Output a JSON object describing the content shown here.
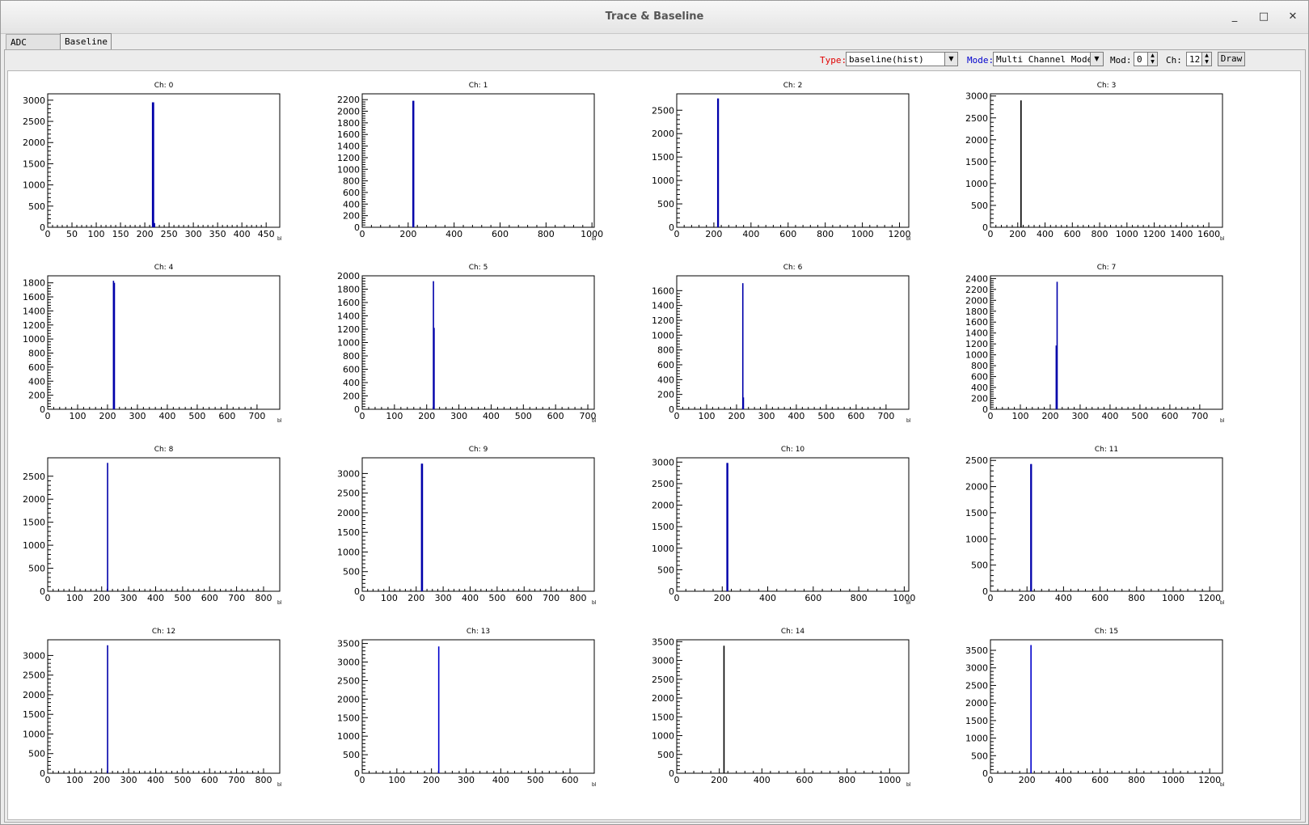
{
  "window": {
    "title": "Trace & Baseline",
    "minimize": "_",
    "maximize": "□",
    "close": "✕"
  },
  "tabs": [
    {
      "label": "ADC Trace"
    },
    {
      "label": "Baseline"
    }
  ],
  "toolbar": {
    "type_label": "Type:",
    "type_value": "baseline(hist)",
    "mode_label": "Mode:",
    "mode_value": "Multi Channel Mode",
    "mod_label": "Mod:",
    "mod_value": "0",
    "ch_label": "Ch:",
    "ch_value": "12",
    "draw_label": "Draw",
    "label_colors": {
      "type": "#e00000",
      "mode": "#0000cc"
    }
  },
  "chart_data": [
    {
      "type": "bar",
      "title": "Ch: 0",
      "xlabel": "bl",
      "xlim": [
        0,
        478
      ],
      "ylim": [
        0,
        3150
      ],
      "xticks": [
        0,
        50,
        100,
        150,
        200,
        250,
        300,
        350,
        400,
        450
      ],
      "yticks": [
        0,
        500,
        1000,
        1500,
        2000,
        2500,
        3000
      ],
      "bins": [
        {
          "x": 216,
          "y": 2950
        },
        {
          "x": 218,
          "y": 2950
        },
        {
          "x": 220,
          "y": 100
        }
      ],
      "color": "#0000aa"
    },
    {
      "type": "bar",
      "title": "Ch: 1",
      "xlabel": "bl",
      "xlim": [
        0,
        1010
      ],
      "ylim": [
        0,
        2300
      ],
      "xticks": [
        0,
        200,
        400,
        600,
        800,
        1000
      ],
      "yticks": [
        0,
        200,
        400,
        600,
        800,
        1000,
        1200,
        1400,
        1600,
        1800,
        2000,
        2200
      ],
      "bins": [
        {
          "x": 221,
          "y": 2180
        },
        {
          "x": 224,
          "y": 2180
        }
      ],
      "color": "#0000aa"
    },
    {
      "type": "bar",
      "title": "Ch: 2",
      "xlabel": "bl",
      "xlim": [
        0,
        1250
      ],
      "ylim": [
        0,
        2850
      ],
      "xticks": [
        0,
        200,
        400,
        600,
        800,
        1000,
        1200
      ],
      "yticks": [
        0,
        500,
        1000,
        1500,
        2000,
        2500
      ],
      "bins": [
        {
          "x": 221,
          "y": 2750
        },
        {
          "x": 224,
          "y": 2750
        }
      ],
      "color": "#0000aa"
    },
    {
      "type": "bar",
      "title": "Ch: 3",
      "xlabel": "bl",
      "xlim": [
        0,
        1700
      ],
      "ylim": [
        0,
        3050
      ],
      "xticks": [
        0,
        200,
        400,
        600,
        800,
        1000,
        1200,
        1400,
        1600
      ],
      "yticks": [
        0,
        500,
        1000,
        1500,
        2000,
        2500,
        3000
      ],
      "bins": [
        {
          "x": 224,
          "y": 2900
        }
      ],
      "color": "#000000"
    },
    {
      "type": "bar",
      "title": "Ch: 4",
      "xlabel": "bl",
      "xlim": [
        0,
        776
      ],
      "ylim": [
        0,
        1900
      ],
      "xticks": [
        0,
        100,
        200,
        300,
        400,
        500,
        600,
        700
      ],
      "yticks": [
        0,
        200,
        400,
        600,
        800,
        1000,
        1200,
        1400,
        1600,
        1800
      ],
      "bins": [
        {
          "x": 220,
          "y": 1830
        },
        {
          "x": 223,
          "y": 1800
        }
      ],
      "color": "#0000aa"
    },
    {
      "type": "bar",
      "title": "Ch: 5",
      "xlabel": "bl",
      "xlim": [
        0,
        720
      ],
      "ylim": [
        0,
        2000
      ],
      "xticks": [
        0,
        100,
        200,
        300,
        400,
        500,
        600,
        700
      ],
      "yticks": [
        0,
        200,
        400,
        600,
        800,
        1000,
        1200,
        1400,
        1600,
        1800,
        2000
      ],
      "bins": [
        {
          "x": 221,
          "y": 1920
        },
        {
          "x": 223,
          "y": 1220
        }
      ],
      "color": "#0000aa"
    },
    {
      "type": "bar",
      "title": "Ch: 6",
      "xlabel": "bl",
      "xlim": [
        0,
        776
      ],
      "ylim": [
        0,
        1800
      ],
      "xticks": [
        0,
        100,
        200,
        300,
        400,
        500,
        600,
        700
      ],
      "yticks": [
        0,
        200,
        400,
        600,
        800,
        1000,
        1200,
        1400,
        1600
      ],
      "bins": [
        {
          "x": 221,
          "y": 1700
        },
        {
          "x": 223,
          "y": 160
        }
      ],
      "color": "#0000aa"
    },
    {
      "type": "bar",
      "title": "Ch: 7",
      "xlabel": "bl",
      "xlim": [
        0,
        776
      ],
      "ylim": [
        0,
        2450
      ],
      "xticks": [
        0,
        100,
        200,
        300,
        400,
        500,
        600,
        700
      ],
      "yticks": [
        0,
        200,
        400,
        600,
        800,
        1000,
        1200,
        1400,
        1600,
        1800,
        2000,
        2200,
        2400
      ],
      "bins": [
        {
          "x": 220,
          "y": 1170
        },
        {
          "x": 223,
          "y": 2340
        }
      ],
      "color": "#0000aa"
    },
    {
      "type": "bar",
      "title": "Ch: 8",
      "xlabel": "bl",
      "xlim": [
        0,
        860
      ],
      "ylim": [
        0,
        2900
      ],
      "xticks": [
        0,
        100,
        200,
        300,
        400,
        500,
        600,
        700,
        800
      ],
      "yticks": [
        0,
        500,
        1000,
        1500,
        2000,
        2500
      ],
      "bins": [
        {
          "x": 222,
          "y": 2790
        }
      ],
      "color": "#0000aa"
    },
    {
      "type": "bar",
      "title": "Ch: 9",
      "xlabel": "bl",
      "xlim": [
        0,
        860
      ],
      "ylim": [
        0,
        3400
      ],
      "xticks": [
        0,
        100,
        200,
        300,
        400,
        500,
        600,
        700,
        800
      ],
      "yticks": [
        0,
        500,
        1000,
        1500,
        2000,
        2500,
        3000
      ],
      "bins": [
        {
          "x": 220,
          "y": 3250
        },
        {
          "x": 223,
          "y": 3250
        }
      ],
      "color": "#0000aa"
    },
    {
      "type": "bar",
      "title": "Ch: 10",
      "xlabel": "bl",
      "xlim": [
        0,
        1020
      ],
      "ylim": [
        0,
        3100
      ],
      "xticks": [
        0,
        200,
        400,
        600,
        800,
        1000
      ],
      "yticks": [
        0,
        500,
        1000,
        1500,
        2000,
        2500,
        3000
      ],
      "bins": [
        {
          "x": 221,
          "y": 2980
        },
        {
          "x": 224,
          "y": 2980
        }
      ],
      "color": "#0000aa"
    },
    {
      "type": "bar",
      "title": "Ch: 11",
      "xlabel": "bl",
      "xlim": [
        0,
        1270
      ],
      "ylim": [
        0,
        2550
      ],
      "xticks": [
        0,
        200,
        400,
        600,
        800,
        1000,
        1200
      ],
      "yticks": [
        0,
        500,
        1000,
        1500,
        2000,
        2500
      ],
      "bins": [
        {
          "x": 221,
          "y": 2430
        },
        {
          "x": 224,
          "y": 2430
        }
      ],
      "color": "#0000aa"
    },
    {
      "type": "bar",
      "title": "Ch: 12",
      "xlabel": "bl",
      "xlim": [
        0,
        860
      ],
      "ylim": [
        0,
        3400
      ],
      "xticks": [
        0,
        100,
        200,
        300,
        400,
        500,
        600,
        700,
        800
      ],
      "yticks": [
        0,
        500,
        1000,
        1500,
        2000,
        2500,
        3000
      ],
      "bins": [
        {
          "x": 222,
          "y": 3260
        }
      ],
      "color": "#0000aa"
    },
    {
      "type": "bar",
      "title": "Ch: 13",
      "xlabel": "bl",
      "xlim": [
        0,
        670
      ],
      "ylim": [
        0,
        3600
      ],
      "xticks": [
        0,
        100,
        200,
        300,
        400,
        500,
        600
      ],
      "yticks": [
        0,
        500,
        1000,
        1500,
        2000,
        2500,
        3000,
        3500
      ],
      "bins": [
        {
          "x": 221,
          "y": 3420
        }
      ],
      "color": "#0000cc"
    },
    {
      "type": "bar",
      "title": "Ch: 14",
      "xlabel": "bl",
      "xlim": [
        0,
        1090
      ],
      "ylim": [
        0,
        3550
      ],
      "xticks": [
        0,
        200,
        400,
        600,
        800,
        1000
      ],
      "yticks": [
        0,
        500,
        1000,
        1500,
        2000,
        2500,
        3000,
        3500
      ],
      "bins": [
        {
          "x": 222,
          "y": 3390
        }
      ],
      "color": "#000000"
    },
    {
      "type": "bar",
      "title": "Ch: 15",
      "xlabel": "bl",
      "xlim": [
        0,
        1270
      ],
      "ylim": [
        0,
        3800
      ],
      "xticks": [
        0,
        200,
        400,
        600,
        800,
        1000,
        1200
      ],
      "yticks": [
        0,
        500,
        1000,
        1500,
        2000,
        2500,
        3000,
        3500
      ],
      "bins": [
        {
          "x": 222,
          "y": 3650
        }
      ],
      "color": "#0000cc"
    }
  ]
}
